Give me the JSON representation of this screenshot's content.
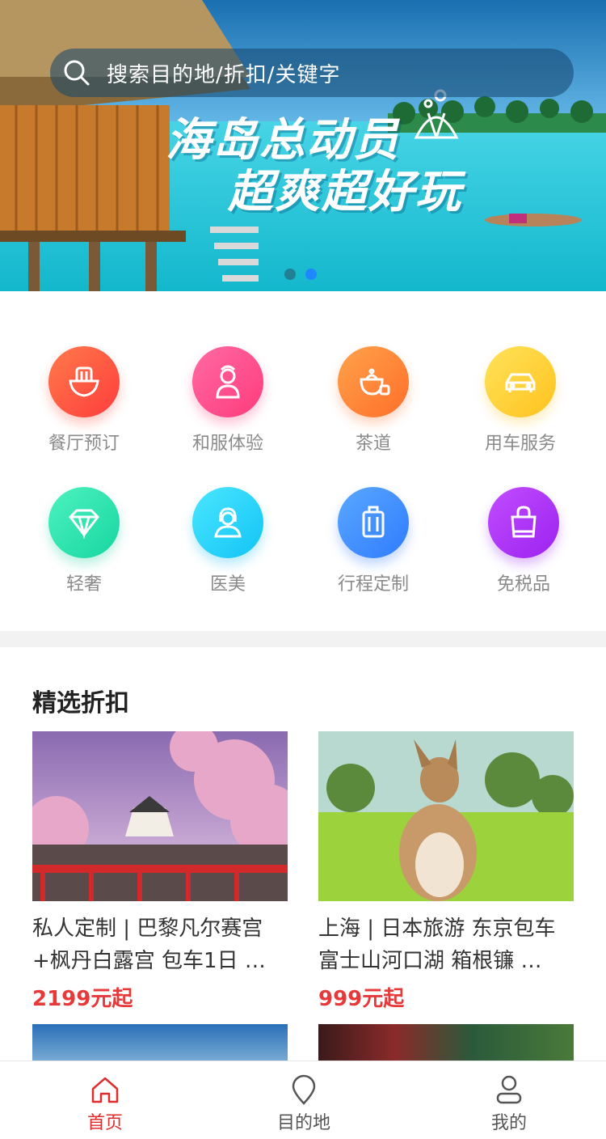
{
  "search": {
    "placeholder": "搜索目的地/折扣/关键字",
    "icon": "search-icon"
  },
  "banner": {
    "headline_1": "海岛总动员",
    "headline_2": "超爽超好玩",
    "slides_total": 2,
    "active_slide": 2
  },
  "categories": [
    {
      "label": "餐厅预订",
      "icon": "bowl-icon",
      "color_from": "#ff7a4a",
      "color_to": "#ff3d3d"
    },
    {
      "label": "和服体验",
      "icon": "kimono-person-icon",
      "color_from": "#ff6aa3",
      "color_to": "#ff3b7c"
    },
    {
      "label": "茶道",
      "icon": "teapot-icon",
      "color_from": "#ffa24a",
      "color_to": "#ff6f2a"
    },
    {
      "label": "用车服务",
      "icon": "car-icon",
      "color_from": "#ffe35a",
      "color_to": "#ffc21f"
    },
    {
      "label": "轻奢",
      "icon": "diamond-icon",
      "color_from": "#4df2c0",
      "color_to": "#17d6a0"
    },
    {
      "label": "医美",
      "icon": "woman-face-icon",
      "color_from": "#4be6ff",
      "color_to": "#12c4f5"
    },
    {
      "label": "行程定制",
      "icon": "luggage-icon",
      "color_from": "#5aa8ff",
      "color_to": "#2f7bff"
    },
    {
      "label": "免税品",
      "icon": "shopping-bag-icon",
      "color_from": "#c24dff",
      "color_to": "#9b22f0"
    }
  ],
  "section": {
    "title": "精选折扣"
  },
  "deals": [
    {
      "title": "私人定制 | 巴黎凡尔赛宫+枫丹白露宫 包车1日 …",
      "price": "2199元起"
    },
    {
      "title": "上海 | 日本旅游 东京包车富士山河口湖 箱根镰 …",
      "price": "999元起"
    }
  ],
  "tabs": [
    {
      "label": "首页",
      "icon": "home-icon",
      "active": true
    },
    {
      "label": "目的地",
      "icon": "location-pin-icon",
      "active": false
    },
    {
      "label": "我的",
      "icon": "user-icon",
      "active": false
    }
  ],
  "colors": {
    "accent": "#e02c2c",
    "price": "#e8393a",
    "dot_active": "#1e88ff"
  }
}
